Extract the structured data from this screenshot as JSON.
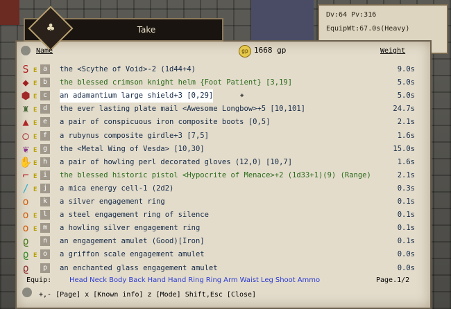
{
  "title": "Take",
  "stats": {
    "line1": "Dv:64 Pv:316",
    "line2": "EquipWt:67.0s(Heavy)"
  },
  "header": {
    "name": "Name",
    "gold": "1668 gp",
    "weight": "Weight"
  },
  "items": [
    {
      "key": "a",
      "name": "the <Scythe of Void>-2  (1d44+4)",
      "weight": "9.0s",
      "sprite": "S",
      "color": "#b02020",
      "green": false,
      "equipped": true,
      "selected": false
    },
    {
      "key": "b",
      "name": "the blessed crimson knight helm {Foot Patient} [3,19]",
      "weight": "5.0s",
      "sprite": "◆",
      "color": "#a02020",
      "green": true,
      "equipped": true,
      "selected": false
    },
    {
      "key": "c",
      "name": "an adamantium large shield+3  [0,29]",
      "weight": "5.0s",
      "sprite": "⬢",
      "color": "#a02828",
      "green": false,
      "equipped": true,
      "selected": true
    },
    {
      "key": "d",
      "name": "the ever lasting plate mail <Awesome Longbow>+5  [10,101]",
      "weight": "24.7s",
      "sprite": "♜",
      "color": "#4a6a3a",
      "green": false,
      "equipped": true,
      "selected": false
    },
    {
      "key": "e",
      "name": "a pair of conspicuous iron composite boots [0,5]",
      "weight": "2.1s",
      "sprite": "▲",
      "color": "#b02828",
      "green": false,
      "equipped": true,
      "selected": false
    },
    {
      "key": "f",
      "name": "a rubynus composite girdle+3  [7,5]",
      "weight": "1.6s",
      "sprite": "◯",
      "color": "#a02020",
      "green": false,
      "equipped": true,
      "selected": false
    },
    {
      "key": "g",
      "name": "the <Metal Wing of Vesda> [10,30]",
      "weight": "15.0s",
      "sprite": "❦",
      "color": "#8a3a8a",
      "green": false,
      "equipped": true,
      "selected": false
    },
    {
      "key": "h",
      "name": "a pair of howling perl decorated gloves (12,0) [10,7]",
      "weight": "1.6s",
      "sprite": "✋",
      "color": "#a02020",
      "green": false,
      "equipped": true,
      "selected": false
    },
    {
      "key": "i",
      "name": "the blessed historic pistol <Hypocrite of Menace>+2  (1d33+1)(9)  (Range)",
      "weight": "2.1s",
      "sprite": "⌐",
      "color": "#b02020",
      "green": true,
      "equipped": true,
      "selected": false
    },
    {
      "key": "j",
      "name": "a mica energy cell-1  (2d2)",
      "weight": "0.3s",
      "sprite": "/",
      "color": "#30b0d0",
      "green": false,
      "equipped": true,
      "selected": false
    },
    {
      "key": "k",
      "name": "a silver engagement ring",
      "weight": "0.1s",
      "sprite": "o",
      "color": "#d06010",
      "green": false,
      "equipped": false,
      "selected": false
    },
    {
      "key": "l",
      "name": "a steel engagement ring of silence",
      "weight": "0.1s",
      "sprite": "o",
      "color": "#d06010",
      "green": false,
      "equipped": true,
      "selected": false
    },
    {
      "key": "m",
      "name": "a howling silver engagement ring",
      "weight": "0.1s",
      "sprite": "o",
      "color": "#d06010",
      "green": false,
      "equipped": true,
      "selected": false
    },
    {
      "key": "n",
      "name": "an engagement amulet (Good)[Iron]",
      "weight": "0.1s",
      "sprite": "ϱ",
      "color": "#4a7a20",
      "green": false,
      "equipped": false,
      "selected": false
    },
    {
      "key": "o",
      "name": "a griffon scale engagement amulet",
      "weight": "0.0s",
      "sprite": "ϱ",
      "color": "#3a8a30",
      "green": false,
      "equipped": true,
      "selected": false
    },
    {
      "key": "p",
      "name": "an enchanted glass engagement amulet",
      "weight": "0.0s",
      "sprite": "ϱ",
      "color": "#8a3030",
      "green": false,
      "equipped": false,
      "selected": false
    }
  ],
  "equip": {
    "label": "Equip:",
    "slots": [
      "Head",
      "Neck",
      "Body",
      "Back",
      "Hand",
      "Hand",
      "Ring",
      "Ring",
      "Arm",
      "Waist",
      "Leg",
      "Shoot",
      "Ammo"
    ],
    "page": "Page.1/2"
  },
  "help": "+,-  [Page]  x [Known info]  z [Mode]  Shift,Esc [Close]"
}
